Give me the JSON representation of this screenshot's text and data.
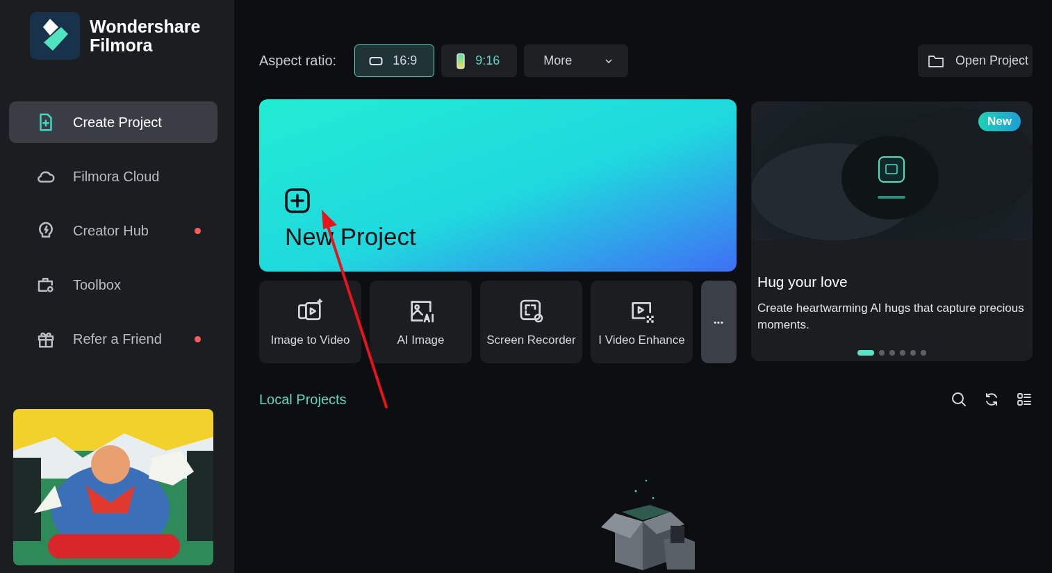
{
  "brand": {
    "name": "Wondershare\nFilmora"
  },
  "nav": [
    {
      "label": "Create Project",
      "selected": true,
      "badge": false
    },
    {
      "label": "Filmora Cloud",
      "selected": false,
      "badge": false
    },
    {
      "label": "Creator Hub",
      "selected": false,
      "badge": true
    },
    {
      "label": "Toolbox",
      "selected": false,
      "badge": false
    },
    {
      "label": "Refer a Friend",
      "selected": false,
      "badge": true
    }
  ],
  "aspect": {
    "label": "Aspect ratio:",
    "options": [
      {
        "label": "16:9",
        "selected": true
      },
      {
        "label": "9:16",
        "selected": false
      }
    ],
    "more": "More"
  },
  "open_project": "Open Project",
  "new_project": {
    "title": "New Project"
  },
  "tools": [
    {
      "label": "Image to Video"
    },
    {
      "label": "AI Image"
    },
    {
      "label": "Screen Recorder"
    },
    {
      "label": "I Video Enhance"
    }
  ],
  "more_tools": "•••",
  "promo": {
    "badge": "New",
    "title": "Hug your love",
    "text": "Create heartwarming AI hugs that capture precious moments.",
    "dots": [
      {
        "selected": true
      },
      {
        "selected": false
      },
      {
        "selected": false
      },
      {
        "selected": false
      },
      {
        "selected": false
      },
      {
        "selected": false
      }
    ]
  },
  "local_projects": {
    "title": "Local Projects"
  }
}
